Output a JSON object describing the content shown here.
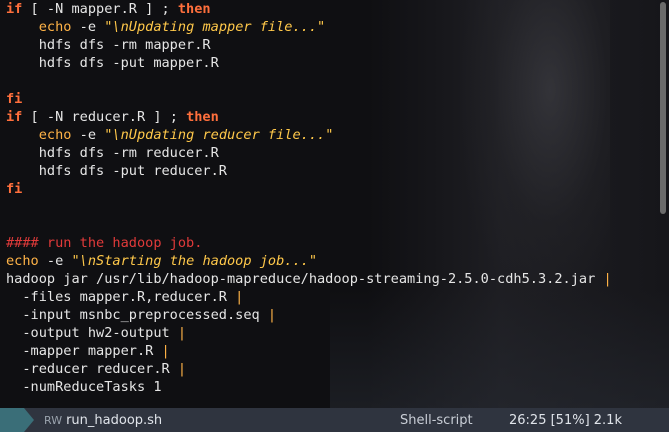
{
  "editor": {
    "lines": [
      [
        [
          "kw",
          "if"
        ],
        [
          "t",
          " [ -N mapper.R ] ; "
        ],
        [
          "kw",
          "then"
        ]
      ],
      [
        [
          "t",
          "    "
        ],
        [
          "builtin",
          "echo"
        ],
        [
          "t",
          " -e "
        ],
        [
          "str",
          "\"\\nUpdating mapper file...\""
        ]
      ],
      [
        [
          "t",
          "    hdfs dfs -rm mapper.R"
        ]
      ],
      [
        [
          "t",
          "    hdfs dfs -put mapper.R"
        ]
      ],
      [
        [
          "t",
          ""
        ]
      ],
      [
        [
          "kw",
          "fi"
        ]
      ],
      [
        [
          "kw",
          "if"
        ],
        [
          "t",
          " [ -N reducer.R ] ; "
        ],
        [
          "kw",
          "then"
        ]
      ],
      [
        [
          "t",
          "    "
        ],
        [
          "builtin",
          "echo"
        ],
        [
          "t",
          " -e "
        ],
        [
          "str",
          "\"\\nUpdating reducer file...\""
        ]
      ],
      [
        [
          "t",
          "    hdfs dfs -rm reducer.R"
        ]
      ],
      [
        [
          "t",
          "    hdfs dfs -put reducer.R"
        ]
      ],
      [
        [
          "kw",
          "fi"
        ]
      ],
      [
        [
          "t",
          ""
        ]
      ],
      [
        [
          "t",
          ""
        ]
      ],
      [
        [
          "comment",
          "#### run the hadoop job."
        ]
      ],
      [
        [
          "builtin",
          "echo"
        ],
        [
          "t",
          " -e "
        ],
        [
          "str",
          "\"\\nStarting the hadoop job...\""
        ]
      ],
      [
        [
          "t",
          "hadoop jar /usr/lib/hadoop-mapreduce/hadoop-streaming-2.5.0-cdh5.3.2.jar "
        ],
        [
          "pipe",
          "|"
        ]
      ],
      [
        [
          "t",
          "  -files mapper.R,reducer.R "
        ],
        [
          "pipe",
          "|"
        ]
      ],
      [
        [
          "t",
          "  -input msnbc_preprocessed.seq "
        ],
        [
          "pipe",
          "|"
        ]
      ],
      [
        [
          "t",
          "  -output hw2-output "
        ],
        [
          "pipe",
          "|"
        ]
      ],
      [
        [
          "t",
          "  -mapper mapper.R "
        ],
        [
          "pipe",
          "|"
        ]
      ],
      [
        [
          "t",
          "  -reducer reducer.R "
        ],
        [
          "pipe",
          "|"
        ]
      ],
      [
        [
          "t",
          "  -numReduceTasks 1"
        ]
      ]
    ]
  },
  "status": {
    "mode": "RW",
    "filename": "run_hadoop.sh",
    "filetype": "Shell-script",
    "position": "26:25 [51%] 2.1k"
  },
  "colors": {
    "keyword": "#ff6f3c",
    "builtin": "#ffb347",
    "string": "#ffc84a",
    "comment": "#e13a3a",
    "statusbar": "#2f343f"
  }
}
